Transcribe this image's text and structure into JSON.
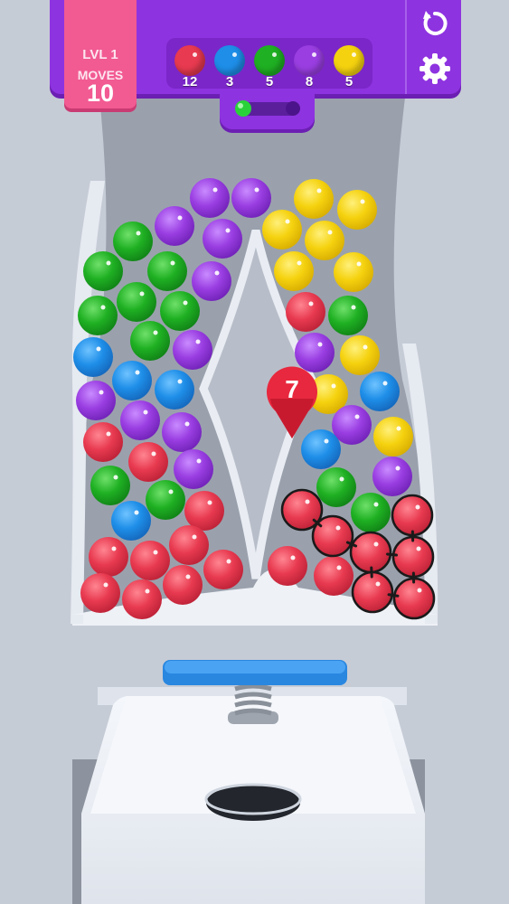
{
  "hud": {
    "level_label": "LVL 1",
    "moves_label": "MOVES",
    "moves_value": "10",
    "colors": {
      "panel": "#8e33e0",
      "card": "#f25a92"
    }
  },
  "ball_counters": [
    {
      "color_name": "red",
      "color": "#e83a50",
      "count": "12"
    },
    {
      "color_name": "blue",
      "color": "#1e8ee8",
      "count": "3"
    },
    {
      "color_name": "green",
      "color": "#1fb023",
      "count": "5"
    },
    {
      "color_name": "purple",
      "color": "#9a3ee2",
      "count": "8"
    },
    {
      "color_name": "yellow",
      "color": "#f5d20f",
      "count": "5"
    }
  ],
  "progress": {
    "fraction": 0.2
  },
  "buttons": {
    "restart_icon": "restart-icon",
    "settings_icon": "gear-icon"
  },
  "selection_badge": {
    "value": "7",
    "color": "#e8283e"
  },
  "board": {
    "selected_group": "red"
  }
}
